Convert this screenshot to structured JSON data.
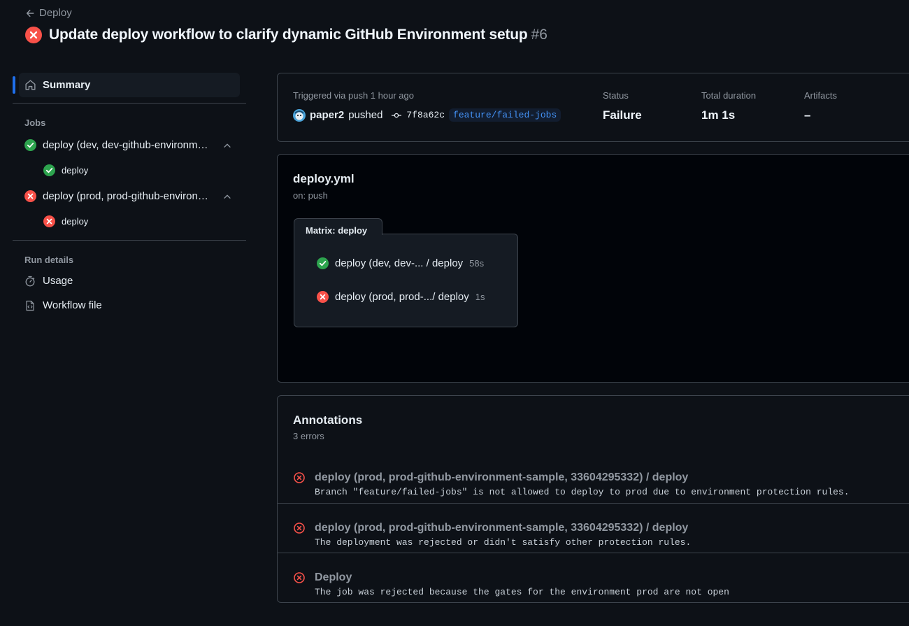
{
  "header": {
    "back_label": "Deploy",
    "title": "Update deploy workflow to clarify dynamic GitHub Environment setup",
    "run_number": "#6",
    "status_icon": "x-circle-fill-icon"
  },
  "sidebar": {
    "summary_label": "Summary",
    "jobs_heading": "Jobs",
    "jobs": [
      {
        "label": "deploy (dev, dev-github-environment-sample)",
        "status": "success",
        "steps": [
          {
            "label": "deploy",
            "status": "success"
          }
        ]
      },
      {
        "label": "deploy (prod, prod-github-environment-sample)",
        "status": "failure",
        "steps": [
          {
            "label": "deploy",
            "status": "failure"
          }
        ]
      }
    ],
    "run_details_heading": "Run details",
    "usage_label": "Usage",
    "workflow_file_label": "Workflow file"
  },
  "info": {
    "trigger_text": "Triggered via push 1 hour ago",
    "actor": "paper2",
    "action": "pushed",
    "commit_sha": "7f8a62c",
    "branch": "feature/failed-jobs",
    "status_label": "Status",
    "status_value": "Failure",
    "duration_label": "Total duration",
    "duration_value": "1m 1s",
    "artifacts_label": "Artifacts",
    "artifacts_value": "–"
  },
  "graph": {
    "file_name": "deploy.yml",
    "trigger": "on: push",
    "matrix_label": "Matrix: deploy",
    "jobs": [
      {
        "label": "deploy (dev, dev-... / deploy",
        "duration": "58s",
        "status": "success"
      },
      {
        "label": "deploy (prod, prod-.../ deploy",
        "duration": "1s",
        "status": "failure"
      }
    ]
  },
  "annotations": {
    "heading": "Annotations",
    "count": "3 errors",
    "items": [
      {
        "title": "deploy (prod, prod-github-environment-sample, 33604295332) / deploy",
        "message": "Branch \"feature/failed-jobs\" is not allowed to deploy to prod due to environment protection rules."
      },
      {
        "title": "deploy (prod, prod-github-environment-sample, 33604295332) / deploy",
        "message": "The deployment was rejected or didn't satisfy other protection rules."
      },
      {
        "title": "Deploy",
        "message": "The job was rejected because the gates for the environment prod are not open"
      }
    ]
  },
  "colors": {
    "success": "#2da44e",
    "failure": "#f85149",
    "accent": "#1f6feb",
    "link": "#4493f8",
    "background": "#0d1117",
    "border": "#3d444d"
  }
}
